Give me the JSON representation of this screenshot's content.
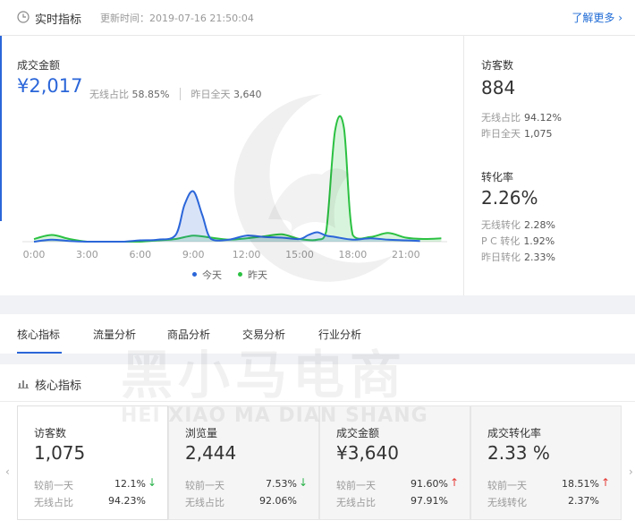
{
  "header": {
    "title": "实时指标",
    "update_time": "更新时间：2019-07-16 21:50:04",
    "more_link": "了解更多 ›"
  },
  "gmv": {
    "label": "成交金额",
    "value": "¥2,017",
    "wireless_label": "无线占比",
    "wireless_value": "58.85%",
    "yesterday_label": "昨日全天",
    "yesterday_value": "3,640"
  },
  "chart_data": {
    "type": "area",
    "x_ticks": [
      "0:00",
      "3:00",
      "6:00",
      "9:00",
      "12:00",
      "15:00",
      "18:00",
      "21:00"
    ],
    "x_range": [
      0,
      23
    ],
    "series": [
      {
        "name": "今天",
        "color": "#2b66d9",
        "points": [
          [
            0,
            0
          ],
          [
            1,
            3
          ],
          [
            2,
            1
          ],
          [
            3,
            0
          ],
          [
            4,
            0
          ],
          [
            5,
            0
          ],
          [
            6,
            2
          ],
          [
            7,
            3
          ],
          [
            8,
            10
          ],
          [
            8.5,
            55
          ],
          [
            9,
            75
          ],
          [
            9.5,
            40
          ],
          [
            10,
            4
          ],
          [
            11,
            3
          ],
          [
            12,
            9
          ],
          [
            13,
            7
          ],
          [
            14,
            6
          ],
          [
            15,
            4
          ],
          [
            15.5,
            10
          ],
          [
            16,
            14
          ],
          [
            16.5,
            9
          ],
          [
            17,
            7
          ],
          [
            18,
            3
          ],
          [
            19,
            5
          ],
          [
            20,
            3
          ],
          [
            21,
            2
          ],
          [
            21.8,
            1
          ]
        ]
      },
      {
        "name": "昨天",
        "color": "#2bc142",
        "points": [
          [
            0,
            4
          ],
          [
            1,
            10
          ],
          [
            2,
            4
          ],
          [
            3,
            0
          ],
          [
            4,
            0
          ],
          [
            5,
            0
          ],
          [
            6,
            0
          ],
          [
            7,
            2
          ],
          [
            8,
            4
          ],
          [
            9,
            9
          ],
          [
            10,
            6
          ],
          [
            11,
            3
          ],
          [
            12,
            5
          ],
          [
            13,
            8
          ],
          [
            14,
            11
          ],
          [
            15,
            4
          ],
          [
            16,
            3
          ],
          [
            16.5,
            15
          ],
          [
            17,
            165
          ],
          [
            17.5,
            170
          ],
          [
            18,
            10
          ],
          [
            19,
            7
          ],
          [
            20,
            13
          ],
          [
            21,
            6
          ],
          [
            22,
            4
          ],
          [
            23,
            5
          ]
        ]
      }
    ],
    "ylim": [
      0,
      180
    ],
    "legend": "bottom-center"
  },
  "right": {
    "visitors_label": "访客数",
    "visitors_value": "884",
    "visitors_rows": [
      {
        "label": "无线占比",
        "value": "94.12%"
      },
      {
        "label": "昨日全天",
        "value": "1,075"
      }
    ],
    "conv_label": "转化率",
    "conv_value": "2.26%",
    "conv_rows": [
      {
        "label": "无线转化",
        "value": "2.28%"
      },
      {
        "label": "P C 转化",
        "value": "1.92%"
      },
      {
        "label": "昨日转化",
        "value": "2.33%"
      }
    ]
  },
  "tabs": [
    "核心指标",
    "流量分析",
    "商品分析",
    "交易分析",
    "行业分析"
  ],
  "core": {
    "title": "核心指标",
    "cards": [
      {
        "label": "访客数",
        "value": "1,075",
        "cmp_label": "较前一天",
        "cmp_value": "12.1%",
        "trend": "down",
        "row2_label": "无线占比",
        "row2_value": "94.23%"
      },
      {
        "label": "浏览量",
        "value": "2,444",
        "cmp_label": "较前一天",
        "cmp_value": "7.53%",
        "trend": "down",
        "row2_label": "无线占比",
        "row2_value": "92.06%"
      },
      {
        "label": "成交金额",
        "value": "¥3,640",
        "cmp_label": "较前一天",
        "cmp_value": "91.60%",
        "trend": "up",
        "row2_label": "无线占比",
        "row2_value": "97.91%"
      },
      {
        "label": "成交转化率",
        "value": "2.33 %",
        "cmp_label": "较前一天",
        "cmp_value": "18.51%",
        "trend": "up",
        "row2_label": "无线转化",
        "row2_value": "2.37%"
      }
    ]
  },
  "watermark": {
    "cn": "黑小马电商",
    "en": "HEI XIAO MA DIAN SHANG"
  },
  "colors": {
    "accent": "#2b66d9",
    "today": "#2b66d9",
    "yesterday": "#2bc142",
    "up": "#e53935",
    "down": "#28b249"
  }
}
